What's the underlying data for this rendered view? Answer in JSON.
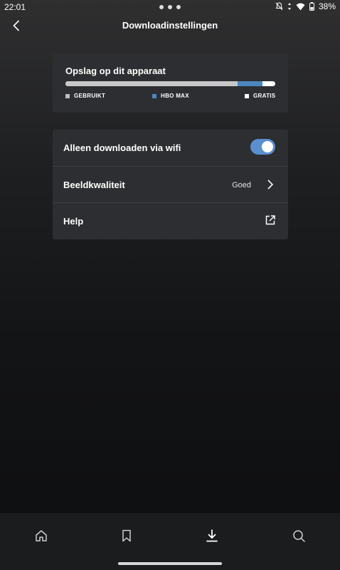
{
  "status": {
    "time": "22:01",
    "battery": "38%"
  },
  "header": {
    "title": "Downloadinstellingen"
  },
  "storage": {
    "title": "Opslag op dit apparaat",
    "used_fraction": 0.82,
    "hbo_fraction": 0.12,
    "free_fraction": 0.06,
    "legend": {
      "used": "GEBRUIKT",
      "hbo": "HBO MAX",
      "free": "GRATIS"
    },
    "colors": {
      "used": "#c8c8c8",
      "hbo": "#4c86c1",
      "free": "#ffffff"
    }
  },
  "settings": {
    "wifi_label": "Alleen downloaden via wifi",
    "wifi_enabled": true,
    "quality_label": "Beeldkwaliteit",
    "quality_value": "Goed",
    "help_label": "Help"
  },
  "nav": {
    "icons": [
      "home-icon",
      "bookmark-icon",
      "download-icon",
      "search-icon"
    ],
    "active": "download-icon"
  },
  "accent": "#5b8fd0"
}
